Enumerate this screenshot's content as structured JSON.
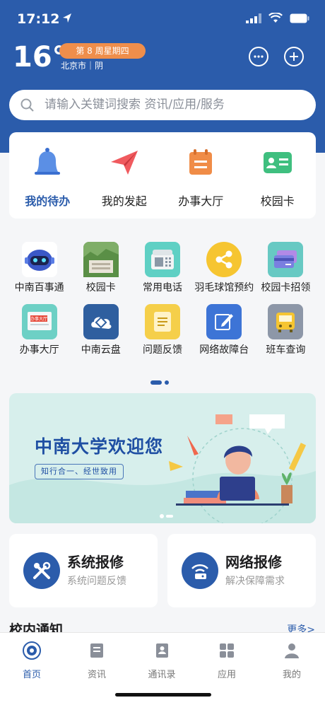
{
  "status_bar": {
    "time": "17:12",
    "colors": {
      "text": "#ffffff"
    }
  },
  "weather": {
    "temperature": "16°",
    "week_badge": "第 8 周星期四",
    "location": "北京市｜阴"
  },
  "header_icons": [
    "message-icon",
    "plus-icon"
  ],
  "search": {
    "placeholder": "请输入关键词搜索 资讯/应用/服务"
  },
  "quick_actions": [
    {
      "label": "我的待办",
      "icon": "bell-icon",
      "active": true
    },
    {
      "label": "我的发起",
      "icon": "paper-plane-icon",
      "active": false
    },
    {
      "label": "办事大厅",
      "icon": "calendar-icon",
      "active": false
    },
    {
      "label": "校园卡",
      "icon": "id-card-icon",
      "active": false
    }
  ],
  "apps_row1": [
    {
      "label": "中南百事通",
      "icon": "robot-icon"
    },
    {
      "label": "校园卡",
      "icon": "campus-photo-icon"
    },
    {
      "label": "常用电话",
      "icon": "telephone-icon"
    },
    {
      "label": "羽毛球馆预约",
      "icon": "share-icon"
    },
    {
      "label": "校园卡招领",
      "icon": "cards-icon"
    }
  ],
  "apps_row2": [
    {
      "label": "办事大厅",
      "icon": "hall-icon"
    },
    {
      "label": "中南云盘",
      "icon": "cloud-disk-icon"
    },
    {
      "label": "问题反馈",
      "icon": "feedback-icon"
    },
    {
      "label": "网络故障台",
      "icon": "edit-icon"
    },
    {
      "label": "班车查询",
      "icon": "bus-icon"
    }
  ],
  "banner": {
    "title": "中南大学欢迎您",
    "motto": "知行合一、经世致用"
  },
  "repairs": [
    {
      "title": "系统报修",
      "subtitle": "系统问题反馈",
      "icon": "tools-icon"
    },
    {
      "title": "网络报修",
      "subtitle": "解决保障需求",
      "icon": "router-icon"
    }
  ],
  "notice": {
    "title": "校内通知",
    "more": "更多>"
  },
  "tabs": [
    {
      "label": "首页",
      "icon": "home-emblem-icon",
      "active": true
    },
    {
      "label": "资讯",
      "icon": "news-icon",
      "active": false
    },
    {
      "label": "通讯录",
      "icon": "contacts-icon",
      "active": false
    },
    {
      "label": "应用",
      "icon": "apps-grid-icon",
      "active": false
    },
    {
      "label": "我的",
      "icon": "person-icon",
      "active": false
    }
  ],
  "colors": {
    "primary": "#2b5cab",
    "accent_orange": "#ef8e4b",
    "banner_bg": "#d7efec"
  }
}
